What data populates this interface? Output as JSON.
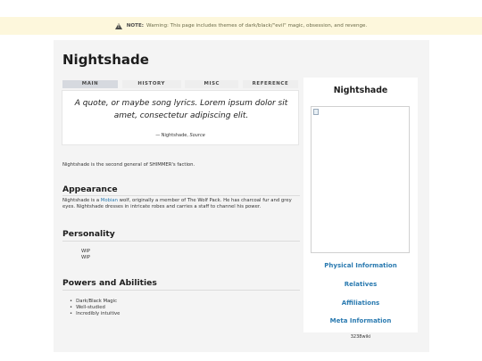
{
  "notice": {
    "icon": "warning-icon",
    "label": "NOTE:",
    "text": "Warning: This page includes themes of dark/black/\"evil\" magic, obsession, and revenge."
  },
  "page": {
    "title": "Nightshade",
    "tabs": [
      {
        "label": "MAIN",
        "active": true
      },
      {
        "label": "HISTORY",
        "active": false
      },
      {
        "label": "MISC",
        "active": false
      },
      {
        "label": "REFERENCE",
        "active": false
      }
    ],
    "quote": {
      "text": "A quote, or maybe song lyrics. Lorem ipsum dolor sit amet, consectetur adipiscing elit.",
      "attribution_prefix": "— Nightshade, ",
      "attribution_source": "Source"
    },
    "intro": "Nightshade is the second general of SHIMMER's faction.",
    "appearance": {
      "heading": "Appearance",
      "text_before": "Nightshade is a ",
      "link": "Mobian",
      "text_after": " wolf, originally a member of The Wolf Pack. He has charcoal fur and grey eyes. Nightshade dresses in intricate robes and carries a staff to channel his power."
    },
    "personality": {
      "heading": "Personality",
      "items": [
        "WIP",
        "WIP"
      ]
    },
    "powers": {
      "heading": "Powers and Abilities",
      "items": [
        "Dark/Black Magic",
        "Well-studied",
        "Incredibly intuitive"
      ]
    }
  },
  "infobox": {
    "title": "Nightshade",
    "sections": [
      "Physical Information",
      "Relatives",
      "Affiliations",
      "Meta Information"
    ],
    "footer": "3238wiki"
  },
  "colors": {
    "notice_bg": "#fdf7dc",
    "page_bg": "#f4f4f4",
    "link": "#2a7ab0",
    "active_tab": "#d6d9df"
  }
}
